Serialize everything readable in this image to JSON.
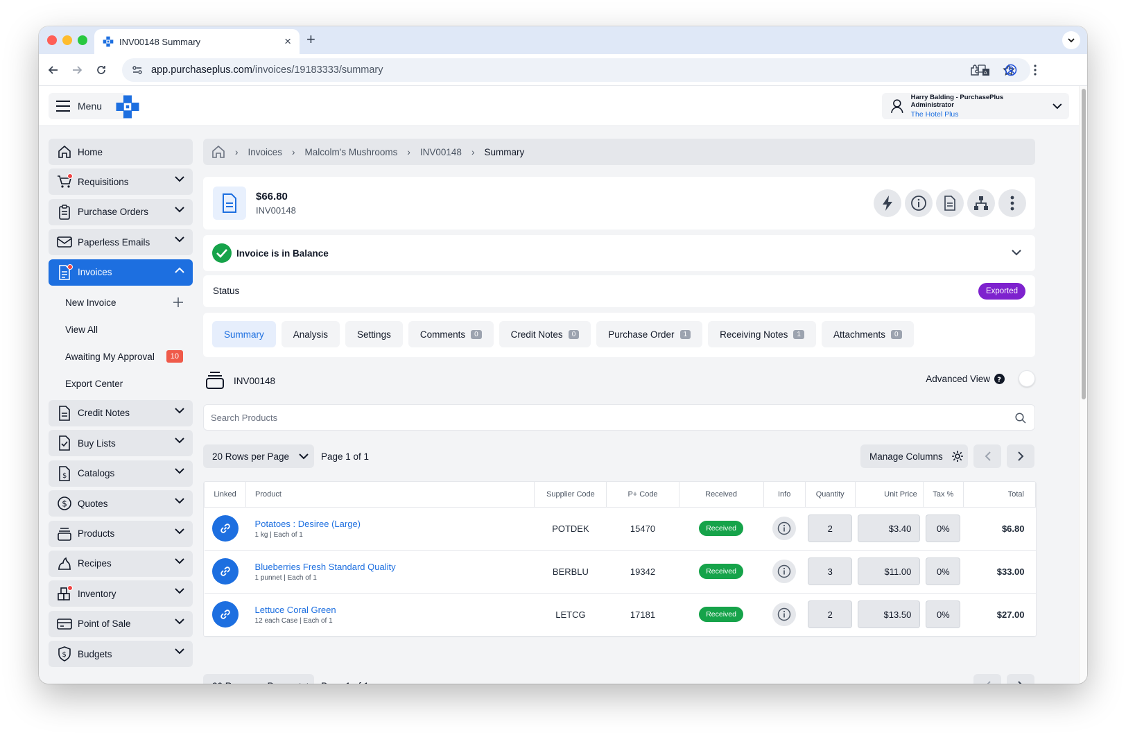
{
  "browser": {
    "tab_title": "INV00148 Summary",
    "url_host": "app.purchaseplus.com",
    "url_path": "/invoices/19183333/summary"
  },
  "header": {
    "menu_label": "Menu",
    "user_name": "Harry Balding - PurchasePlus Administrator",
    "org_name": "The Hotel Plus"
  },
  "sidebar": {
    "items": [
      {
        "label": "Home",
        "icon": "home-icon"
      },
      {
        "label": "Requisitions",
        "icon": "cart-icon"
      },
      {
        "label": "Purchase Orders",
        "icon": "clipboard-icon"
      },
      {
        "label": "Paperless Emails",
        "icon": "envelope-icon"
      },
      {
        "label": "Invoices",
        "icon": "invoice-icon"
      },
      {
        "label": "Credit Notes",
        "icon": "document-icon"
      },
      {
        "label": "Buy Lists",
        "icon": "checklist-icon"
      },
      {
        "label": "Catalogs",
        "icon": "catalog-icon"
      },
      {
        "label": "Quotes",
        "icon": "dollar-icon"
      },
      {
        "label": "Products",
        "icon": "products-icon"
      },
      {
        "label": "Recipes",
        "icon": "recipe-icon"
      },
      {
        "label": "Inventory",
        "icon": "inventory-icon"
      },
      {
        "label": "Point of Sale",
        "icon": "pos-icon"
      },
      {
        "label": "Budgets",
        "icon": "budget-icon"
      }
    ],
    "invoices_sub": {
      "new_invoice": "New Invoice",
      "view_all": "View All",
      "awaiting": "Awaiting My Approval",
      "awaiting_count": "10",
      "export_center": "Export Center"
    }
  },
  "breadcrumb": [
    "Invoices",
    "Malcolm's Mushrooms",
    "INV00148",
    "Summary"
  ],
  "invoice": {
    "amount": "$66.80",
    "number": "INV00148",
    "balance_text": "Invoice is in Balance",
    "status_label": "Status",
    "status_value": "Exported"
  },
  "tabs": [
    {
      "label": "Summary",
      "count": null
    },
    {
      "label": "Analysis",
      "count": null
    },
    {
      "label": "Settings",
      "count": null
    },
    {
      "label": "Comments",
      "count": "0"
    },
    {
      "label": "Credit Notes",
      "count": "0"
    },
    {
      "label": "Purchase Order",
      "count": "1"
    },
    {
      "label": "Receiving Notes",
      "count": "1"
    },
    {
      "label": "Attachments",
      "count": "0"
    }
  ],
  "section": {
    "title": "INV00148",
    "advanced_view": "Advanced View",
    "search_placeholder": "Search Products",
    "rows_per_page": "20 Rows per Page",
    "page_info": "Page 1 of 1",
    "manage_columns": "Manage Columns"
  },
  "table": {
    "columns": [
      "Linked",
      "Product",
      "Supplier Code",
      "P+ Code",
      "Received",
      "Info",
      "Quantity",
      "Unit Price",
      "Tax %",
      "Total"
    ],
    "rows": [
      {
        "product": "Potatoes : Desiree (Large)",
        "desc": "1 kg | Each of 1",
        "supplier_code": "POTDEK",
        "p_code": "15470",
        "received": "Received",
        "quantity": "2",
        "unit_price": "$3.40",
        "tax": "0%",
        "total": "$6.80"
      },
      {
        "product": "Blueberries Fresh Standard Quality",
        "desc": "1 punnet | Each of 1",
        "supplier_code": "BERBLU",
        "p_code": "19342",
        "received": "Received",
        "quantity": "3",
        "unit_price": "$11.00",
        "tax": "0%",
        "total": "$33.00"
      },
      {
        "product": "Lettuce Coral Green",
        "desc": "12 each Case | Each of 1",
        "supplier_code": "LETCG",
        "p_code": "17181",
        "received": "Received",
        "quantity": "2",
        "unit_price": "$13.50",
        "tax": "0%",
        "total": "$27.00"
      }
    ]
  },
  "colors": {
    "accent": "#1d6fe0",
    "success": "#16a34a",
    "exported": "#7e22ce",
    "alert": "#ef4444"
  }
}
